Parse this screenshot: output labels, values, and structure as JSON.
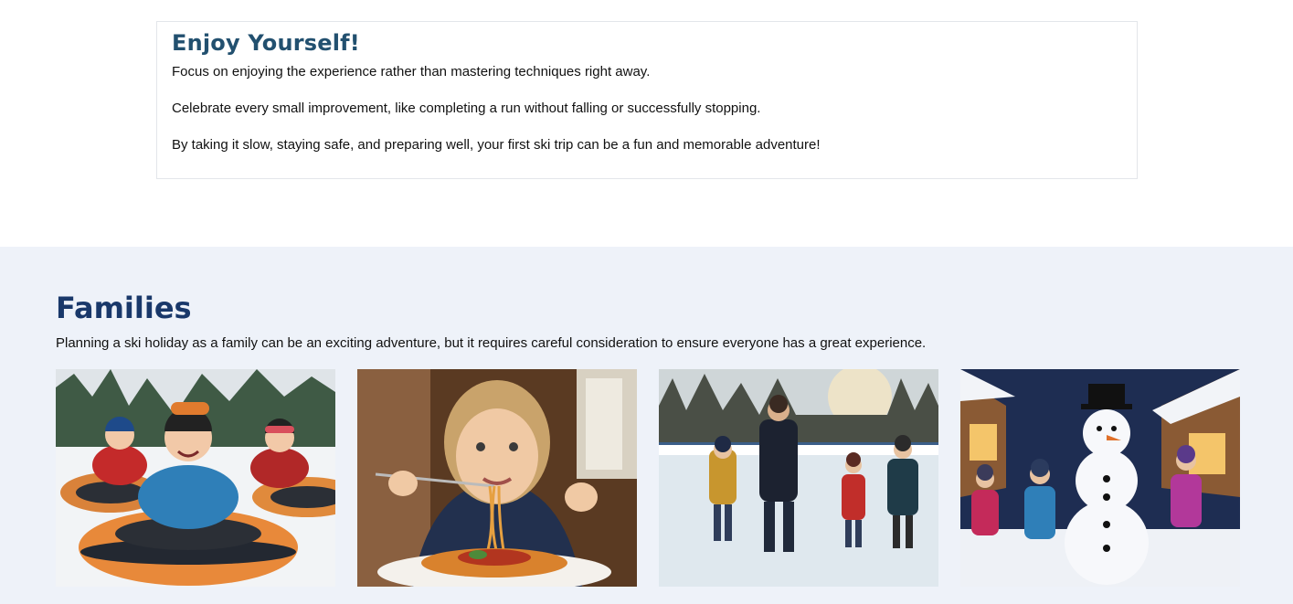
{
  "tip_card": {
    "title": "Enjoy Yourself!",
    "paragraphs": [
      "Focus on enjoying the experience rather than mastering techniques right away.",
      "Celebrate every small improvement, like completing a run without falling or successfully stopping.",
      "By taking it slow, staying safe, and preparing well, your first ski trip can be a fun and memorable adventure!"
    ]
  },
  "families": {
    "title": "Families",
    "intro": "Planning a ski holiday as a family can be an exciting adventure, but it requires careful consideration to ensure everyone has a great experience.",
    "photos": [
      {
        "subject": "children-snow-tubing"
      },
      {
        "subject": "child-eating-spaghetti"
      },
      {
        "subject": "family-ice-skating"
      },
      {
        "subject": "children-building-snowman"
      }
    ]
  },
  "colors": {
    "card_title": "#22506f",
    "section_title": "#19386a",
    "section_bg": "#eef2f9",
    "card_border": "#e3e6ea"
  }
}
